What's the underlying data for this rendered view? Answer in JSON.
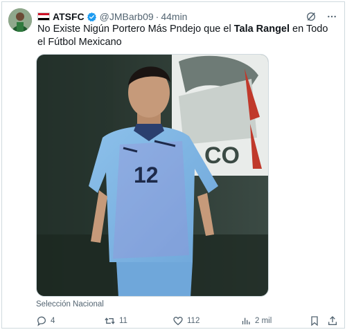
{
  "tweet": {
    "display_name": "ATSFC",
    "handle": "@JMBarb09",
    "separator": "·",
    "time": "44min",
    "text_before": "No Existe Nigún Portero Más Pndejo que el ",
    "text_bold": "Tala Rangel",
    "text_after": " en Todo el Fútbol Mexicano",
    "media_caption": "Selección Nacional",
    "media_text": {
      "crest_text": "CO",
      "jersey_number": "12"
    }
  },
  "actions": {
    "replies": "4",
    "reposts": "11",
    "likes": "112",
    "views": "2 mil"
  },
  "colors": {
    "muted": "#536471",
    "verified_blue": "#1d9bf0",
    "border": "#cfd9de",
    "jersey": "#7fb3e0"
  },
  "icons": [
    "grok-icon",
    "more-icon",
    "reply-icon",
    "repost-icon",
    "like-icon",
    "views-icon",
    "bookmark-icon",
    "share-icon",
    "verified-badge-icon"
  ]
}
